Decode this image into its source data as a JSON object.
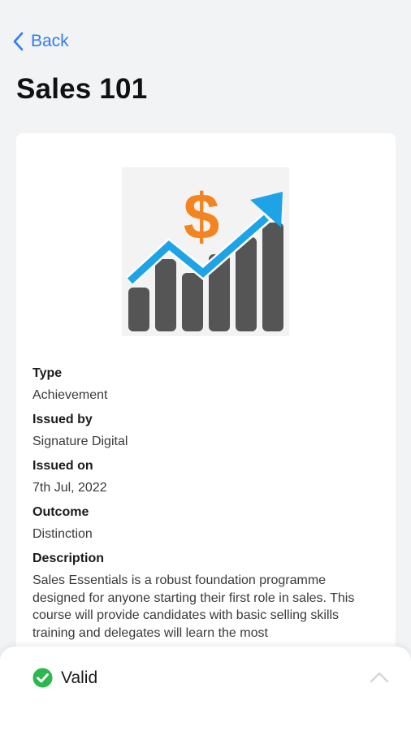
{
  "nav": {
    "back_label": "Back"
  },
  "page": {
    "title": "Sales 101"
  },
  "badge": {
    "image_icon": "sales-growth-chart-icon",
    "symbol": "$",
    "colors": {
      "dollar": "#f4841f",
      "arrow": "#1ea3e6",
      "bars": "#555555",
      "background": "#f3f3f3"
    }
  },
  "details": {
    "type": {
      "label": "Type",
      "value": "Achievement"
    },
    "issued_by": {
      "label": "Issued by",
      "value": "Signature Digital"
    },
    "issued_on": {
      "label": "Issued on",
      "value": "7th Jul, 2022"
    },
    "outcome": {
      "label": "Outcome",
      "value": "Distinction"
    },
    "description": {
      "label": "Description",
      "value": "Sales Essentials is a robust foundation programme designed for anyone starting their first role in sales. This course will provide candidates with basic selling skills training and delegates will learn the most"
    }
  },
  "status": {
    "label": "Valid",
    "icon": "check-circle-icon",
    "color": "#2db84d"
  },
  "colors": {
    "accent": "#2f7cf6",
    "background": "#f2f3f5"
  }
}
